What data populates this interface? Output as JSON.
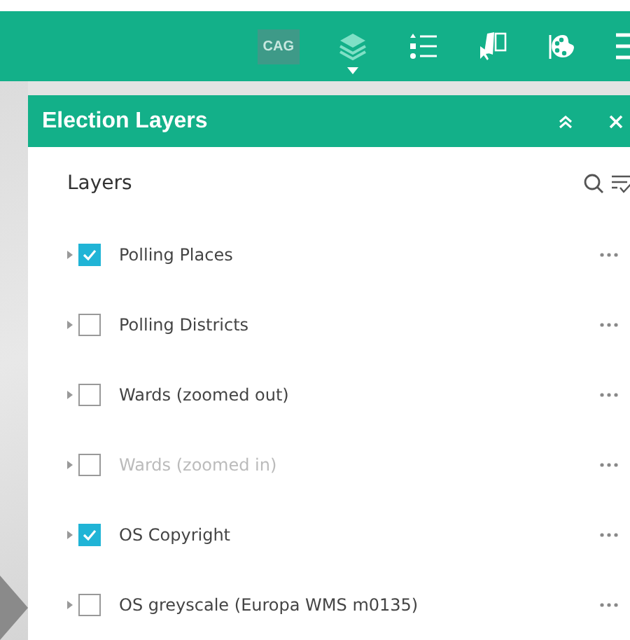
{
  "toolbar": {
    "items": [
      {
        "kind": "badge",
        "label": "CAG",
        "selected": false
      },
      {
        "kind": "layers",
        "selected": true
      },
      {
        "kind": "legend",
        "selected": false
      },
      {
        "kind": "select",
        "selected": false
      },
      {
        "kind": "palette",
        "selected": false
      },
      {
        "kind": "menu",
        "selected": false
      }
    ]
  },
  "panel": {
    "title": "Election Layers",
    "heading": "Layers",
    "layers": [
      {
        "name": "Polling Places",
        "checked": true,
        "disabled": false
      },
      {
        "name": "Polling Districts",
        "checked": false,
        "disabled": false
      },
      {
        "name": "Wards (zoomed out)",
        "checked": false,
        "disabled": false
      },
      {
        "name": "Wards (zoomed in)",
        "checked": false,
        "disabled": true
      },
      {
        "name": "OS Copyright",
        "checked": true,
        "disabled": false
      },
      {
        "name": "OS greyscale (Europa WMS m0135)",
        "checked": false,
        "disabled": false
      }
    ]
  }
}
